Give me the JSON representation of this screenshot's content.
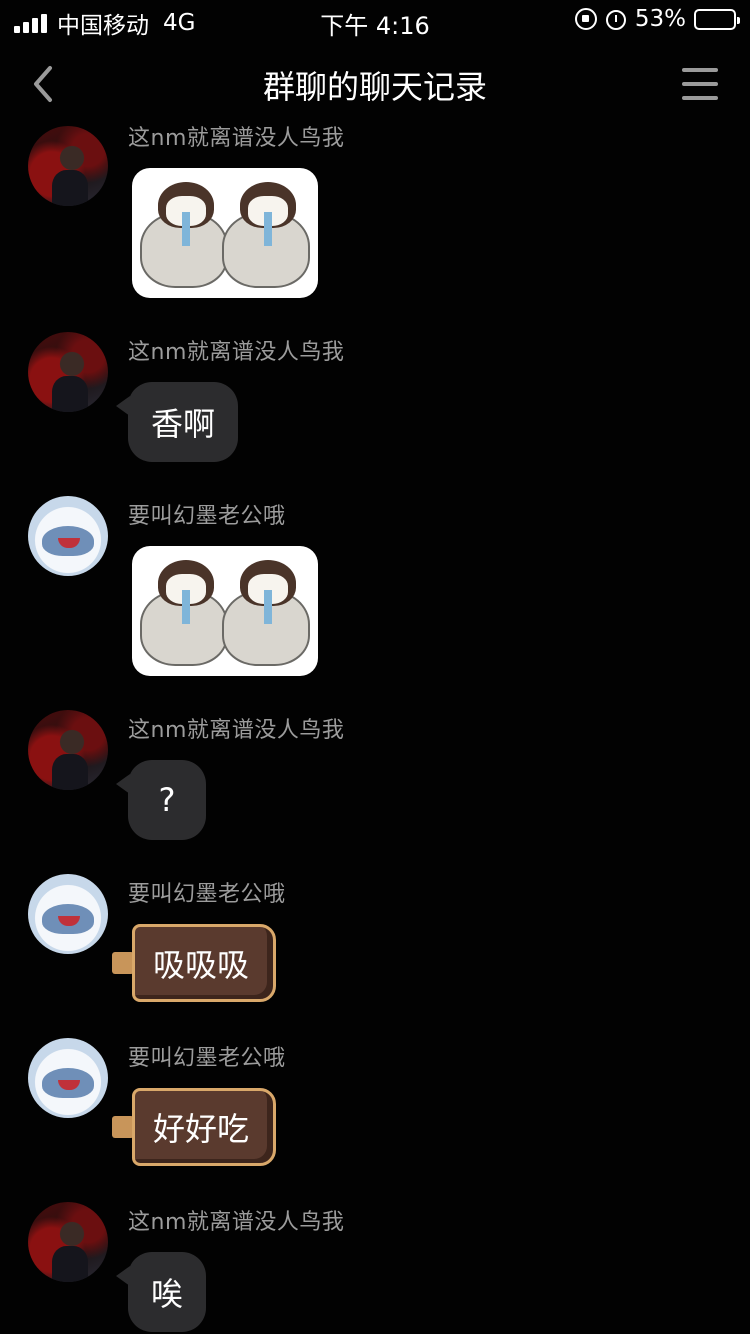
{
  "status_bar": {
    "carrier": "中国移动",
    "network": "4G",
    "time": "下午 4:16",
    "battery_percent": "53%",
    "battery_level": 0.53,
    "battery_color": "#f2c900"
  },
  "nav": {
    "title": "群聊的聊天记录",
    "back_icon": "chevron-left-icon",
    "menu_icon": "hamburger-menu-icon"
  },
  "messages": [
    {
      "sender": "这nm就离谱没人鸟我",
      "type": "sticker",
      "content": "penguin-sticker"
    },
    {
      "sender": "这nm就离谱没人鸟我",
      "type": "text",
      "text": "香啊"
    },
    {
      "sender": "要叫幻墨老公哦",
      "type": "sticker",
      "content": "penguin-sticker"
    },
    {
      "sender": "这nm就离谱没人鸟我",
      "type": "text",
      "text": "?"
    },
    {
      "sender": "要叫幻墨老公哦",
      "type": "chocolate-bubble",
      "text": "吸吸吸"
    },
    {
      "sender": "要叫幻墨老公哦",
      "type": "chocolate-bubble",
      "text": "好好吃"
    },
    {
      "sender": "这nm就离谱没人鸟我",
      "type": "text",
      "text": "唉"
    }
  ]
}
